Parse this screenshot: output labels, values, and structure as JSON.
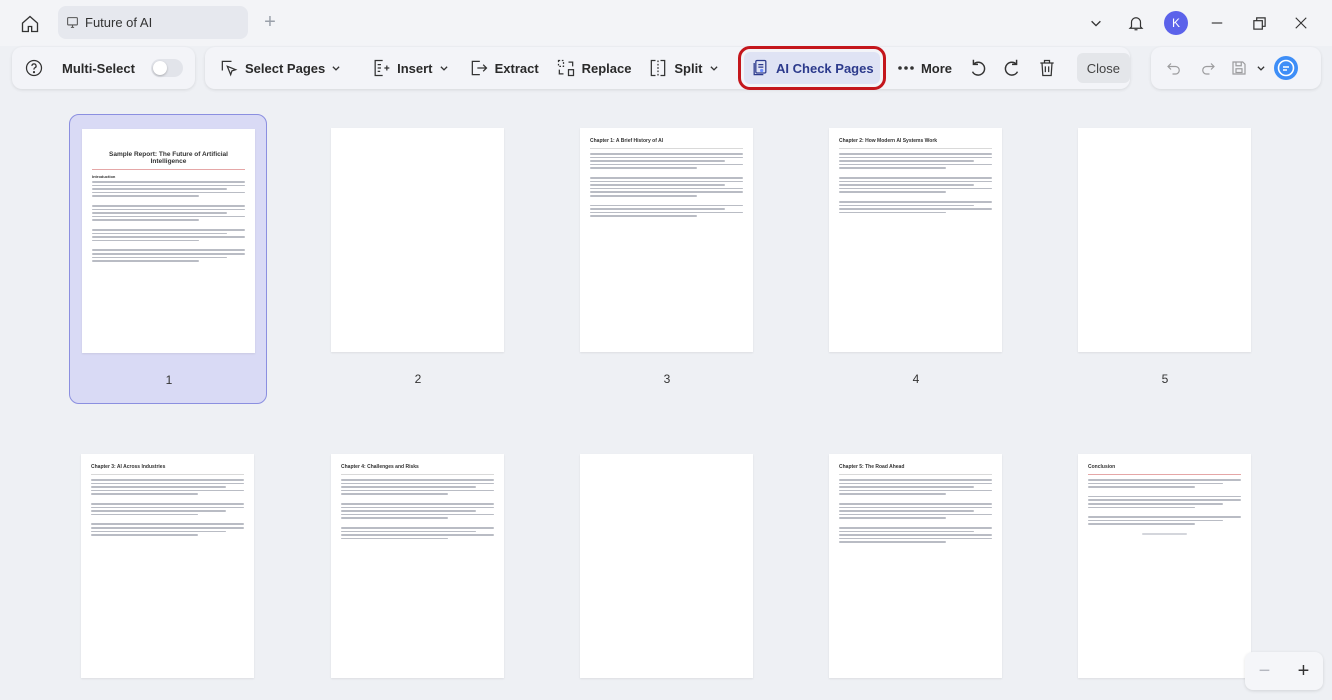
{
  "titlebar": {
    "tab_title": "Future of AI",
    "tab_add": "+",
    "avatar_initial": "K",
    "avatar_color": "#5b62ea"
  },
  "toolbar": {
    "multi_select_label": "Multi-Select",
    "select_pages_label": "Select Pages",
    "insert_label": "Insert",
    "extract_label": "Extract",
    "replace_label": "Replace",
    "split_label": "Split",
    "ai_check_label": "AI Check Pages",
    "more_label": "More",
    "close_label": "Close",
    "highlight_color": "#c4161c"
  },
  "pages": [
    {
      "number": "1",
      "title": "Sample Report: The Future of Artificial Intelligence",
      "subtitle": "Introduction",
      "selected": true
    },
    {
      "number": "2",
      "title": "",
      "subtitle": "",
      "selected": false
    },
    {
      "number": "3",
      "title": "Chapter 1: A Brief History of AI",
      "subtitle": "",
      "selected": false
    },
    {
      "number": "4",
      "title": "Chapter 2: How Modern AI Systems Work",
      "subtitle": "",
      "selected": false
    },
    {
      "number": "5",
      "title": "",
      "subtitle": "",
      "selected": false
    },
    {
      "number": "",
      "title": "Chapter 3: AI Across Industries",
      "subtitle": "",
      "selected": false
    },
    {
      "number": "",
      "title": "Chapter 4: Challenges and Risks",
      "subtitle": "",
      "selected": false
    },
    {
      "number": "",
      "title": "",
      "subtitle": "",
      "selected": false
    },
    {
      "number": "",
      "title": "Chapter 5: The Road Ahead",
      "subtitle": "",
      "selected": false
    },
    {
      "number": "",
      "title": "Conclusion",
      "subtitle": "",
      "selected": false
    }
  ],
  "zoom": {
    "minus": "−",
    "plus": "+"
  }
}
